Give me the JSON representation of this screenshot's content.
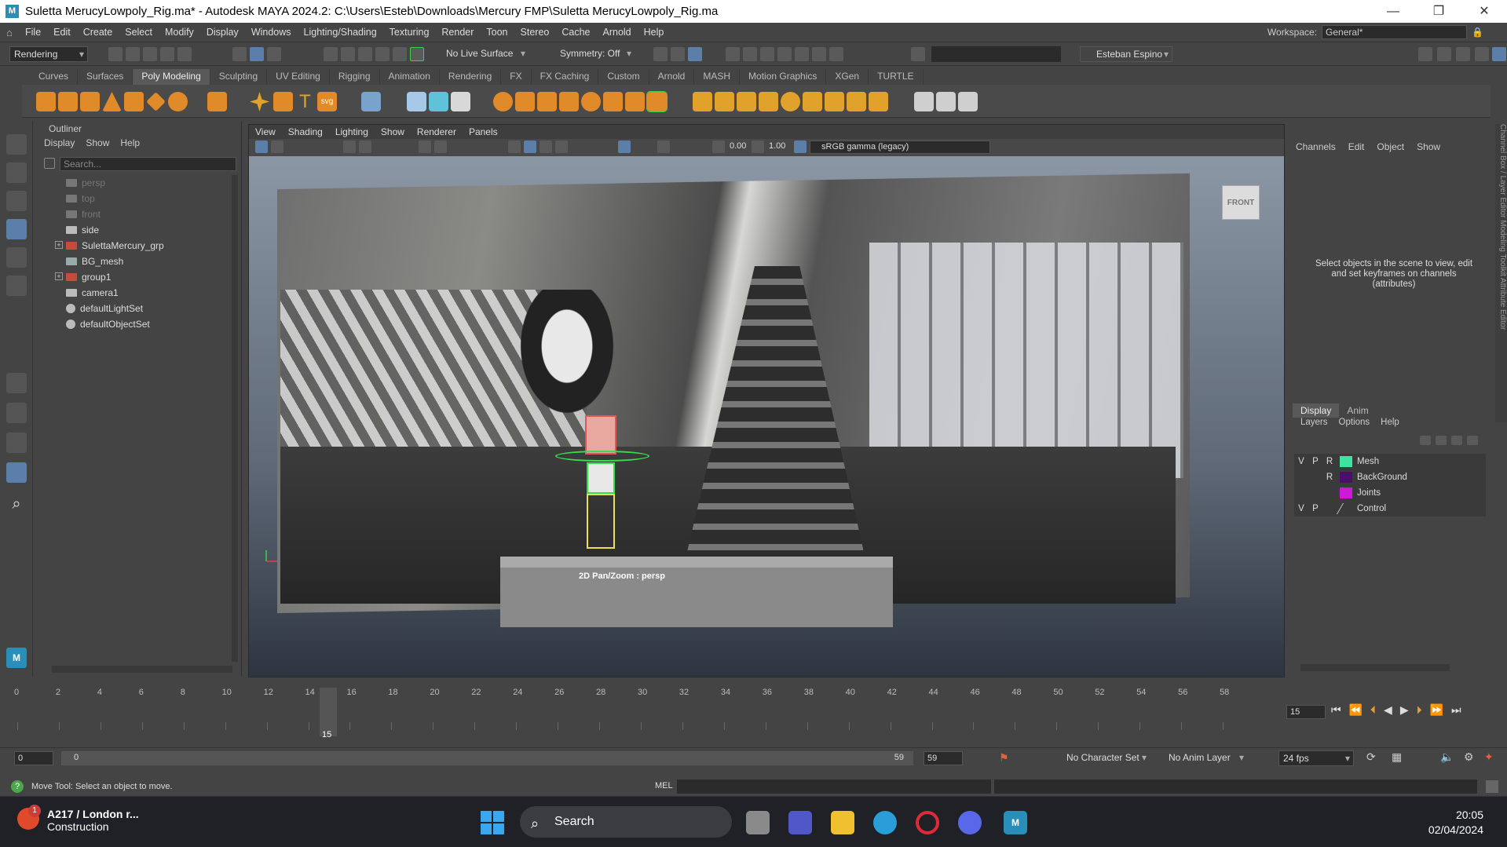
{
  "window": {
    "title": "Suletta MerucyLowpoly_Rig.ma* - Autodesk MAYA 2024.2: C:\\Users\\Esteb\\Downloads\\Mercury FMP\\Suletta MerucyLowpoly_Rig.ma",
    "app_badge": "M",
    "controls": [
      "—",
      "❐",
      "✕"
    ]
  },
  "menubar": {
    "items": [
      "File",
      "Edit",
      "Create",
      "Select",
      "Modify",
      "Display",
      "Windows",
      "Lighting/Shading",
      "Texturing",
      "Render",
      "Toon",
      "Stereo",
      "Cache",
      "Arnold",
      "Help"
    ],
    "workspace_label": "Workspace:",
    "workspace_value": "General*"
  },
  "statusline": {
    "menuset": "Rendering",
    "live_surface": "No Live Surface",
    "symmetry": "Symmetry: Off",
    "user": "Esteban Espino"
  },
  "shelf": {
    "tabs": [
      "Curves",
      "Surfaces",
      "Poly Modeling",
      "Sculpting",
      "UV Editing",
      "Rigging",
      "Animation",
      "Rendering",
      "FX",
      "FX Caching",
      "Custom",
      "Arnold",
      "MASH",
      "Motion Graphics",
      "XGen",
      "TURTLE"
    ],
    "active": "Poly Modeling"
  },
  "outliner": {
    "title": "Outliner",
    "menu": [
      "Display",
      "Show",
      "Help"
    ],
    "search_placeholder": "Search...",
    "items": [
      {
        "label": "persp",
        "dim": true,
        "expand": false
      },
      {
        "label": "top",
        "dim": true,
        "expand": false
      },
      {
        "label": "front",
        "dim": true,
        "expand": false
      },
      {
        "label": "side",
        "dim": false,
        "expand": false
      },
      {
        "label": "SulettaMercury_grp",
        "dim": false,
        "expand": true
      },
      {
        "label": "BG_mesh",
        "dim": false,
        "expand": false
      },
      {
        "label": "group1",
        "dim": false,
        "expand": true
      },
      {
        "label": "camera1",
        "dim": false,
        "expand": false
      },
      {
        "label": "defaultLightSet",
        "dim": false,
        "expand": false
      },
      {
        "label": "defaultObjectSet",
        "dim": false,
        "expand": false
      }
    ]
  },
  "viewport": {
    "menu": [
      "View",
      "Shading",
      "Lighting",
      "Show",
      "Renderer",
      "Panels"
    ],
    "exposure": "0.00",
    "gamma": "1.00",
    "colorspace": "sRGB gamma (legacy)",
    "viewcube": "FRONT",
    "hud": "2D Pan/Zoom : persp"
  },
  "channelbox": {
    "menu": [
      "Channels",
      "Edit",
      "Object",
      "Show"
    ],
    "message": "Select objects in the scene to view, edit and set keyframes on channels (attributes)",
    "side_tabs": "Channel Box / Layer Editor   Modeling Toolkit   Attribute Editor"
  },
  "layereditor": {
    "tabs": [
      "Display",
      "Anim"
    ],
    "active": "Display",
    "menu": [
      "Layers",
      "Options",
      "Help"
    ],
    "layers": [
      {
        "v": "V",
        "p": "P",
        "r": "R",
        "name": "Mesh",
        "color": "#3de3a0"
      },
      {
        "v": "",
        "p": "",
        "r": "R",
        "name": "BackGround",
        "color": "#4a0f6a"
      },
      {
        "v": "",
        "p": "",
        "r": "",
        "name": "Joints",
        "color": "#d018d8"
      },
      {
        "v": "V",
        "p": "P",
        "r": "",
        "name": "Control",
        "color": ""
      }
    ]
  },
  "timeline": {
    "ticks": [
      "0",
      "2",
      "4",
      "6",
      "8",
      "10",
      "12",
      "14",
      "16",
      "18",
      "20",
      "22",
      "24",
      "26",
      "28",
      "30",
      "32",
      "34",
      "36",
      "38",
      "40",
      "42",
      "44",
      "46",
      "48",
      "50",
      "52",
      "54",
      "56",
      "58"
    ],
    "current": "15",
    "current_field": "15"
  },
  "range": {
    "start": "0",
    "inner_start": "0",
    "inner_end": "59",
    "end": "59",
    "character_set": "No Character Set",
    "anim_layer": "No Anim Layer",
    "fps": "24 fps"
  },
  "cmdline": {
    "help": "Move Tool: Select an object to move.",
    "mel_label": "MEL"
  },
  "taskbar": {
    "weather_title": "A217 / London r...",
    "weather_sub": "Construction",
    "weather_badge": "1",
    "search": "Search",
    "time": "20:05",
    "date": "02/04/2024"
  }
}
